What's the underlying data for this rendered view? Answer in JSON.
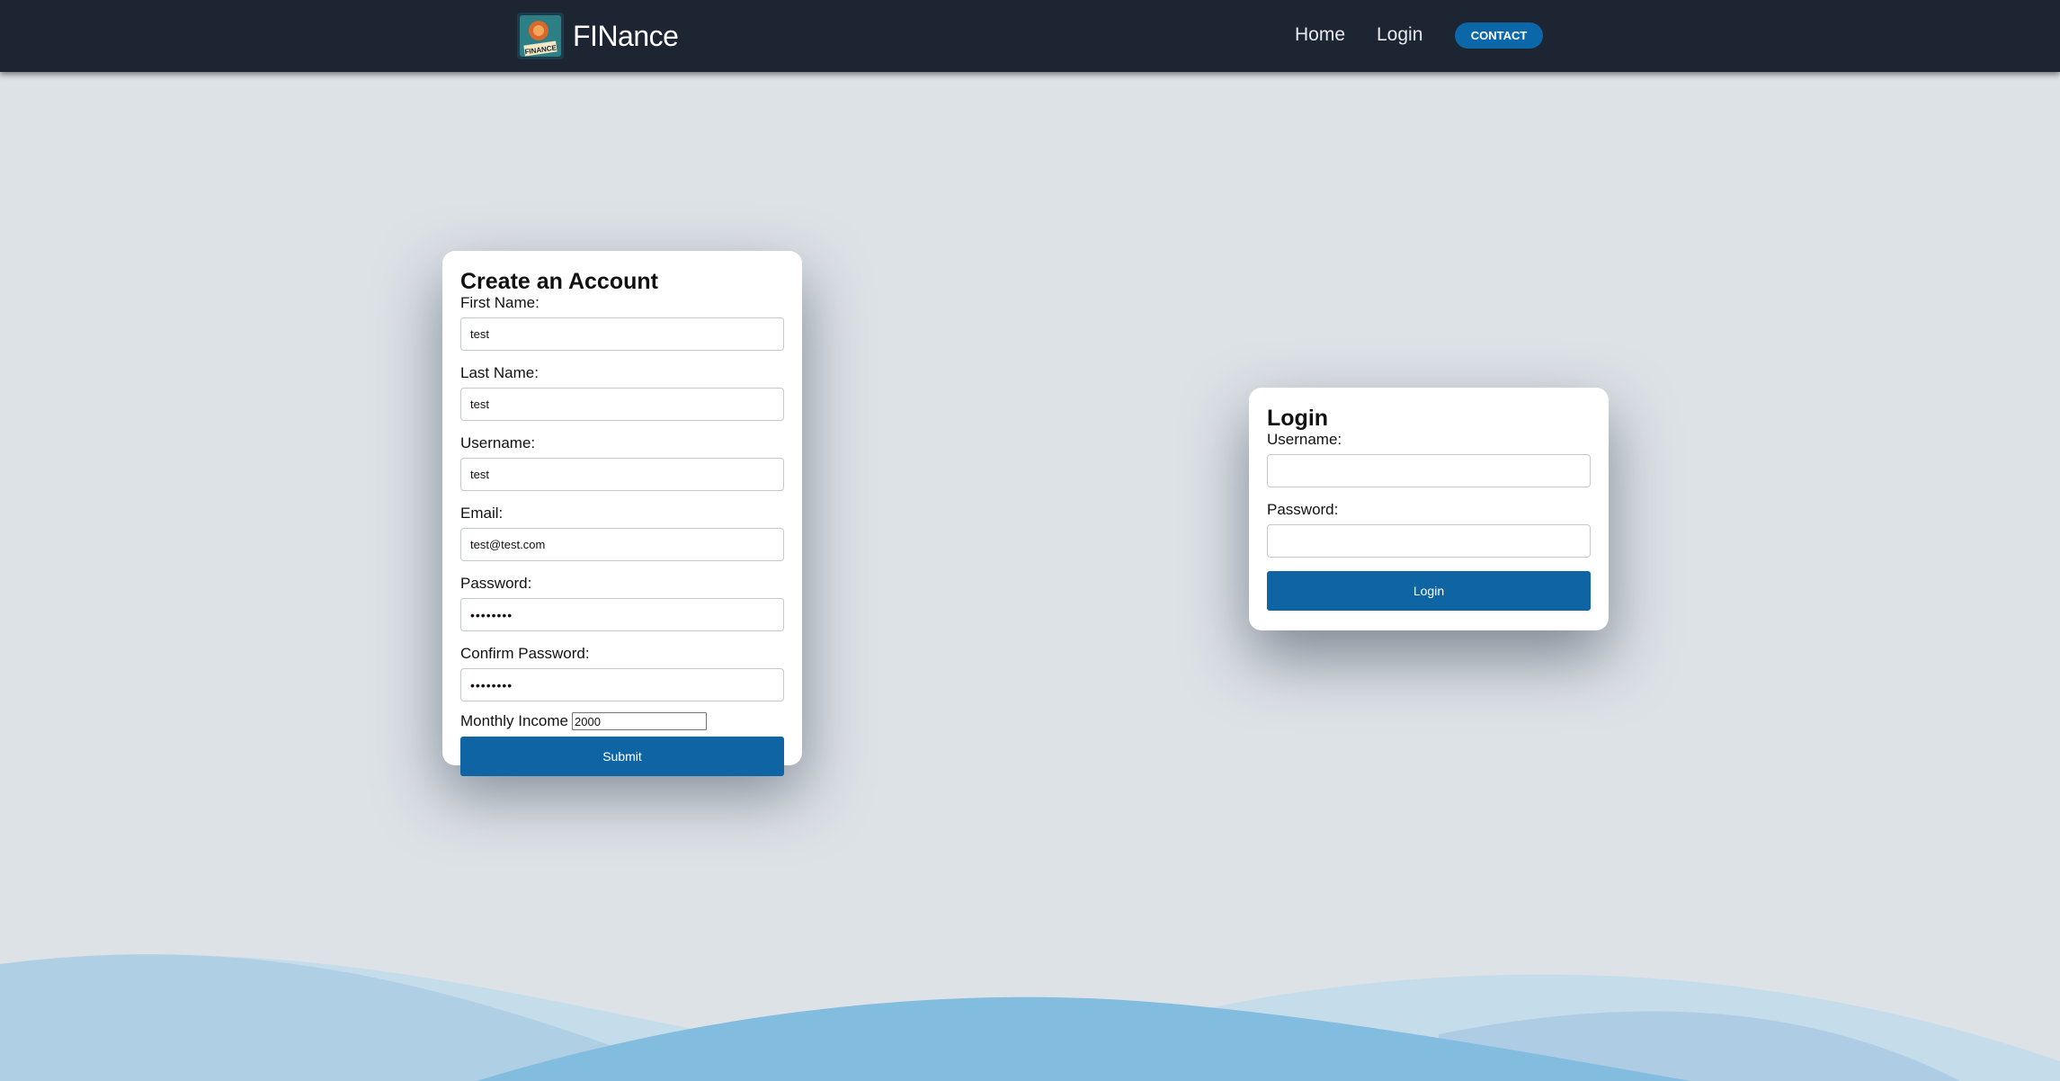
{
  "nav": {
    "brand": "FINance",
    "logo_text": "FINANCE",
    "links": [
      "Home",
      "Login"
    ],
    "contact_label": "CONTACT"
  },
  "signup": {
    "title": "Create an Account",
    "first_name_label": "First Name:",
    "first_name_value": "test",
    "last_name_label": "Last Name:",
    "last_name_value": "test",
    "username_label": "Username:",
    "username_value": "test",
    "email_label": "Email:",
    "email_value": "test@test.com",
    "password_label": "Password:",
    "password_value": "••••••••",
    "confirm_password_label": "Confirm Password:",
    "confirm_password_value": "••••••••",
    "income_label": "Monthly Income",
    "income_value": "2000",
    "submit_label": "Submit"
  },
  "login": {
    "title": "Login",
    "username_label": "Username:",
    "password_label": "Password:",
    "submit_label": "Login"
  },
  "colors": {
    "navbar": "#1d2432",
    "page_bg": "#dde2e7",
    "primary": "#0f65a3",
    "wave_light": "#b2d1e6",
    "wave_mid": "#83bcdf"
  }
}
